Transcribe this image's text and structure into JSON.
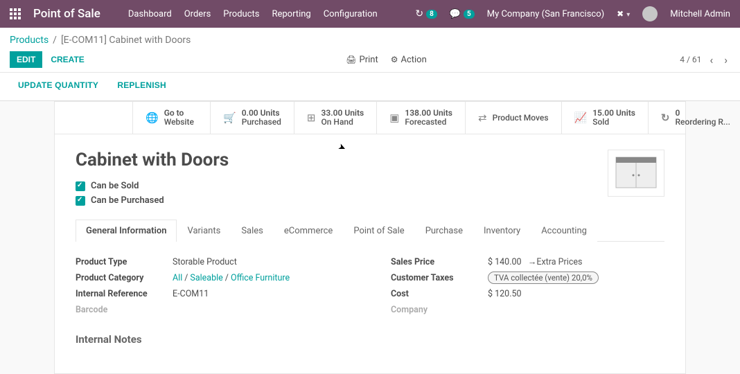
{
  "header": {
    "app_title": "Point of Sale",
    "menu": [
      "Dashboard",
      "Orders",
      "Products",
      "Reporting",
      "Configuration"
    ],
    "clock_badge": "8",
    "chat_badge": "5",
    "company": "My Company (San Francisco)",
    "user": "Mitchell Admin"
  },
  "breadcrumb": {
    "root": "Products",
    "leaf": "[E-COM11] Cabinet with Doors"
  },
  "actions": {
    "edit": "EDIT",
    "create": "CREATE",
    "print": "Print",
    "action": "Action",
    "pager": "4 / 61",
    "update_quantity": "UPDATE QUANTITY",
    "replenish": "REPLENISH"
  },
  "stats": {
    "website": [
      "Go to",
      "Website"
    ],
    "purchased": [
      "0.00 Units",
      "Purchased"
    ],
    "onhand": [
      "33.00 Units",
      "On Hand"
    ],
    "forecasted": [
      "138.00 Units",
      "Forecasted"
    ],
    "moves": [
      "",
      "Product Moves"
    ],
    "sold": [
      "15.00 Units",
      "Sold"
    ],
    "reorder": [
      "0",
      "Reordering R..."
    ]
  },
  "product": {
    "name": "Cabinet with Doors",
    "can_sold_label": "Can be Sold",
    "can_purchased_label": "Can be Purchased"
  },
  "tabs": [
    "General Information",
    "Variants",
    "Sales",
    "eCommerce",
    "Point of Sale",
    "Purchase",
    "Inventory",
    "Accounting"
  ],
  "fields_left": {
    "product_type": {
      "label": "Product Type",
      "value": "Storable Product"
    },
    "product_category": {
      "label": "Product Category",
      "parts": [
        "All",
        "Saleable",
        "Office Furniture"
      ]
    },
    "internal_ref": {
      "label": "Internal Reference",
      "value": "E-COM11"
    },
    "barcode": {
      "label": "Barcode",
      "value": ""
    }
  },
  "fields_right": {
    "sales_price": {
      "label": "Sales Price",
      "value": "$ 140.00",
      "extra": "Extra Prices"
    },
    "customer_taxes": {
      "label": "Customer Taxes",
      "tag": "TVA collectée (vente) 20,0%"
    },
    "cost": {
      "label": "Cost",
      "value": "$ 120.50"
    },
    "company": {
      "label": "Company",
      "value": ""
    }
  },
  "section_internal_notes": "Internal Notes"
}
